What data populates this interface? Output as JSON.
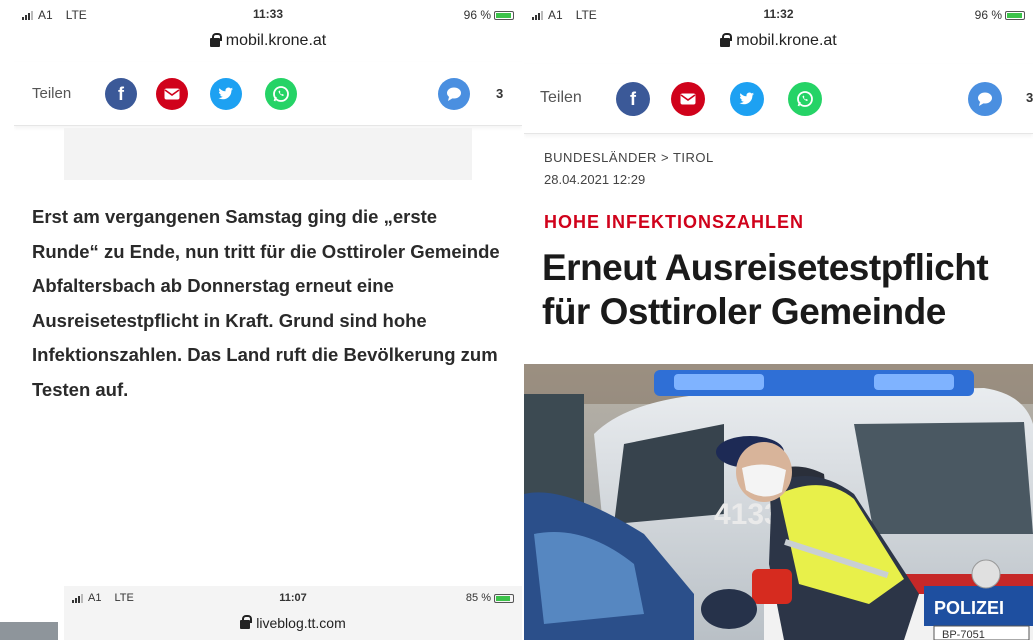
{
  "left": {
    "status": {
      "carrier": "A1",
      "network": "LTE",
      "time": "11:33",
      "battery": "96 %"
    },
    "url": "mobil.krone.at",
    "share_label": "Teilen",
    "comment_count": "3",
    "paragraph": "Erst am vergangenen Samstag ging die „erste Runde“ zu Ende, nun tritt für die Osttiroler Gemeinde Abfaltersbach ab Donnerstag erneut eine Ausreisetestpflicht in Kraft. Grund sind hohe Infektionszahlen. Das Land ruft die Bevölkerung zum Testen auf."
  },
  "right": {
    "status": {
      "carrier": "A1",
      "network": "LTE",
      "time": "11:32",
      "battery": "96 %"
    },
    "url": "mobil.krone.at",
    "share_label": "Teilen",
    "comment_count": "3",
    "breadcrumb": "BUNDESLÄNDER > TIROL",
    "date": "28.04.2021 12:29",
    "kicker": "HOHE INFEKTIONSZAHLEN",
    "headline": "Erneut Ausreisetestpflicht für Osttiroler Gemeinde",
    "photo_text": {
      "car_number": "4133",
      "police": "POLIZEI",
      "plate": "BP-7051"
    }
  },
  "bottom": {
    "status": {
      "carrier": "A1",
      "network": "LTE",
      "time": "11:07",
      "battery": "85 %"
    },
    "url": "liveblog.tt.com"
  },
  "colors": {
    "facebook": "#3b5998",
    "mail": "#d0021b",
    "twitter": "#1da1f2",
    "whatsapp": "#25d366",
    "kicker": "#d0021b"
  }
}
